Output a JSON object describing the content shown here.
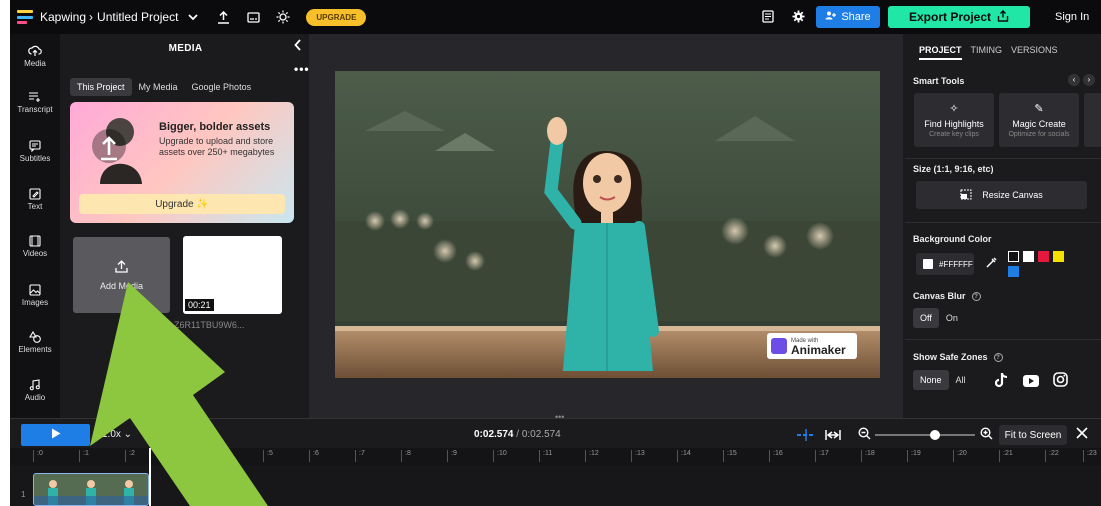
{
  "colors": {
    "accent_blue": "#1f7de6",
    "export_green": "#20e6a6",
    "upgrade_yellow": "#f7c02a",
    "arrow_green": "#8dc63f"
  },
  "topbar": {
    "brand": "Kapwing",
    "separator": "›",
    "project_title": "Untitled Project",
    "upgrade_label": "UPGRADE",
    "share_label": "Share",
    "export_label": "Export Project",
    "signin_label": "Sign In",
    "icons": [
      "chevron-down-icon",
      "upload-icon",
      "subtitle-icon",
      "lightbulb-icon",
      "notes-icon",
      "gear-icon",
      "add-user-icon"
    ]
  },
  "rail": [
    {
      "id": "media",
      "label": "Media"
    },
    {
      "id": "transcript",
      "label": "Transcript"
    },
    {
      "id": "subtitles",
      "label": "Subtitles"
    },
    {
      "id": "text",
      "label": "Text"
    },
    {
      "id": "videos",
      "label": "Videos"
    },
    {
      "id": "images",
      "label": "Images"
    },
    {
      "id": "elements",
      "label": "Elements"
    },
    {
      "id": "audio",
      "label": "Audio"
    }
  ],
  "media_panel": {
    "title": "MEDIA",
    "tabs": [
      "This Project",
      "My Media",
      "Google Photos"
    ],
    "promo": {
      "title": "Bigger, bolder assets",
      "description": "Upgrade to upload and store assets over 250+ megabytes",
      "button": "Upgrade ✨"
    },
    "add_media_label": "Add Media",
    "asset": {
      "duration": "00:21",
      "name": "Z6R11TBU9W6..."
    }
  },
  "canvas": {
    "watermark_small": "Made with",
    "watermark_brand": "Animaker"
  },
  "right_panel": {
    "tabs": [
      "PROJECT",
      "TIMING",
      "VERSIONS"
    ],
    "smart_tools_label": "Smart Tools",
    "tools": [
      {
        "title": "Find Highlights",
        "subtitle": "Create key clips"
      },
      {
        "title": "Magic Create",
        "subtitle": "Optimize for socials"
      }
    ],
    "size_label": "Size (1:1, 9:16, etc)",
    "resize_label": "Resize Canvas",
    "bg_color_label": "Background Color",
    "bg_hex": "#FFFFFF",
    "swatches": [
      "#111111",
      "#ffffff",
      "#e6193c",
      "#f5e000",
      "#1f7de6"
    ],
    "blur_label": "Canvas Blur",
    "blur_options": [
      "Off",
      "On"
    ],
    "safe_zones_label": "Show Safe Zones",
    "safe_zone_options": [
      "None",
      "All"
    ]
  },
  "timeline": {
    "speed": "1.0x",
    "current_time": "0:02.574",
    "total_time": "/ 0:02.574",
    "fit_label": "Fit to Screen",
    "track_number": "1",
    "ruler": [
      ":0",
      ":1",
      ":2",
      ":3",
      ":4",
      ":5",
      ":6",
      ":7",
      ":8",
      ":9",
      ":10",
      ":11",
      ":12",
      ":13",
      ":14",
      ":15",
      ":16",
      ":17",
      ":18",
      ":19",
      ":20",
      ":21",
      ":22",
      ":23"
    ]
  }
}
